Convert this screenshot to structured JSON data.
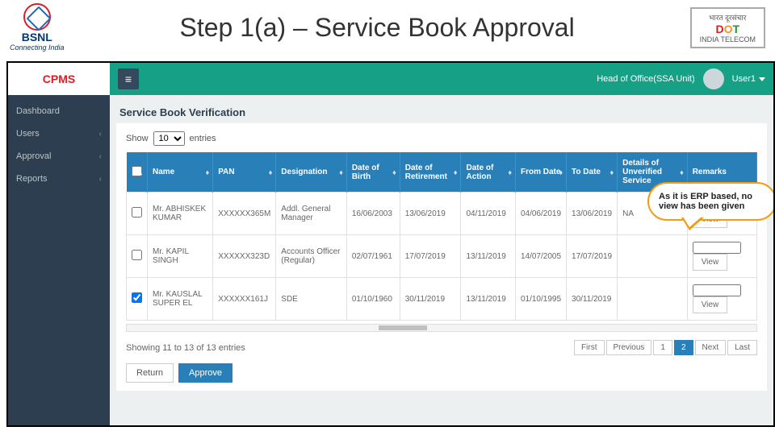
{
  "slide": {
    "title": "Step 1(a) – Service Book Approval",
    "bsnl_name": "BSNL",
    "bsnl_tag": "Connecting India",
    "dot_top": "भारत दूरसंचार",
    "dot_big_d": "D",
    "dot_big_o": "O",
    "dot_big_t": "T",
    "dot_bottom": "INDIA TELECOM"
  },
  "app": {
    "brand": "CPMS",
    "role_label": "Head of Office(SSA Unit)",
    "user_label": "User1"
  },
  "sidebar": {
    "items": [
      {
        "label": "Dashboard"
      },
      {
        "label": "Users"
      },
      {
        "label": "Approval"
      },
      {
        "label": "Reports"
      }
    ]
  },
  "panel": {
    "title": "Service Book Verification",
    "show_prefix": "Show",
    "show_value": "10",
    "show_suffix": "entries",
    "columns": [
      "",
      "Name",
      "PAN",
      "Designation",
      "Date of Birth",
      "Date of Retirement",
      "Date of Action",
      "From Date",
      "To Date",
      "Details of Unverified Service",
      "Remarks"
    ],
    "rows": [
      {
        "name": "Mr. ABHISKEK KUMAR",
        "pan": "XXXXXX365M",
        "desig": "Addl. General Manager",
        "dob": "16/06/2003",
        "dor": "13/06/2019",
        "doa": "04/11/2019",
        "from": "04/06/2019",
        "to": "13/06/2019",
        "unver": "NA",
        "remarks": "",
        "view": "View"
      },
      {
        "name": "Mr. KAPIL SINGH",
        "pan": "XXXXXX323D",
        "desig": "Accounts Officer (Regular)",
        "dob": "02/07/1961",
        "dor": "17/07/2019",
        "doa": "13/11/2019",
        "from": "14/07/2005",
        "to": "17/07/2019",
        "unver": "",
        "remarks": "",
        "view": "View"
      },
      {
        "name": "Mr. KAUSLAL SUPER EL",
        "pan": "XXXXXX161J",
        "desig": "SDE",
        "dob": "01/10/1960",
        "dor": "30/11/2019",
        "doa": "13/11/2019",
        "from": "01/10/1995",
        "to": "30/11/2019",
        "unver": "",
        "remarks": "",
        "view": "View"
      }
    ],
    "footer_info": "Showing 11 to 13 of 13 entries",
    "pager": [
      "First",
      "Previous",
      "1",
      "2",
      "Next",
      "Last"
    ],
    "pager_active_index": 3,
    "return_label": "Return",
    "approve_label": "Approve"
  },
  "callout": {
    "text": "As it is ERP based, no view has been given"
  }
}
